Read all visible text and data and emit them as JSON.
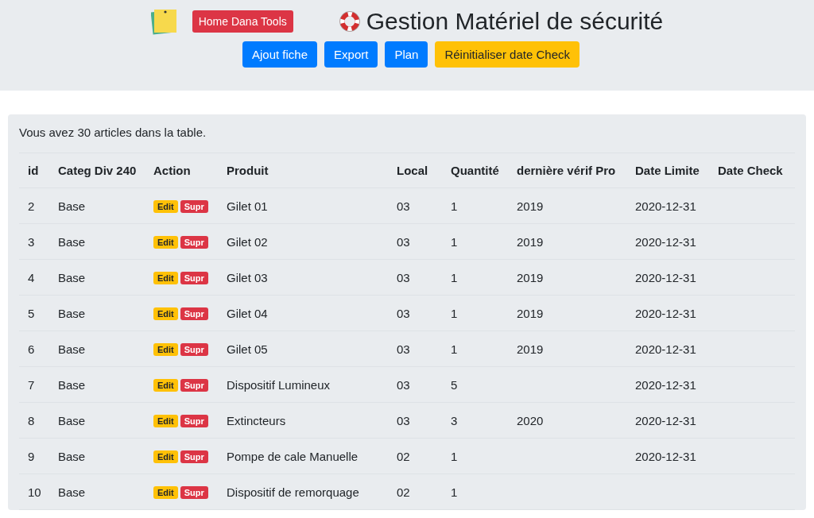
{
  "header": {
    "home_button": "Home Dana Tools",
    "title": "Gestion Matériel de sécurité",
    "buttons": [
      {
        "label": "Ajout fiche",
        "kind": "primary"
      },
      {
        "label": "Export",
        "kind": "primary"
      },
      {
        "label": "Plan",
        "kind": "primary"
      },
      {
        "label": "Réinitialiser date Check",
        "kind": "warning"
      }
    ]
  },
  "summary": "Vous avez 30 articles dans la table.",
  "table": {
    "columns": [
      "id",
      "Categ Div 240",
      "Action",
      "Produit",
      "Local",
      "Quantité",
      "dernière vérif Pro",
      "Date Limite",
      "Date Check"
    ],
    "rows": [
      {
        "id": "2",
        "categ": "Base",
        "actions": [
          "Edit",
          "Supr"
        ],
        "produit": "Gilet 01",
        "local": "03",
        "quantite": "1",
        "verif": "2019",
        "limite": "2020-12-31"
      },
      {
        "id": "3",
        "categ": "Base",
        "actions": [
          "Edit",
          "Supr"
        ],
        "produit": "Gilet 02",
        "local": "03",
        "quantite": "1",
        "verif": "2019",
        "limite": "2020-12-31"
      },
      {
        "id": "4",
        "categ": "Base",
        "actions": [
          "Edit",
          "Supr"
        ],
        "produit": "Gilet 03",
        "local": "03",
        "quantite": "1",
        "verif": "2019",
        "limite": "2020-12-31"
      },
      {
        "id": "5",
        "categ": "Base",
        "actions": [
          "Edit",
          "Supr"
        ],
        "produit": "Gilet 04",
        "local": "03",
        "quantite": "1",
        "verif": "2019",
        "limite": "2020-12-31"
      },
      {
        "id": "6",
        "categ": "Base",
        "actions": [
          "Edit",
          "Supr"
        ],
        "produit": "Gilet 05",
        "local": "03",
        "quantite": "1",
        "verif": "2019",
        "limite": "2020-12-31"
      },
      {
        "id": "7",
        "categ": "Base",
        "actions": [
          "Edit",
          "Supr"
        ],
        "produit": "Dispositif Lumineux",
        "local": "03",
        "quantite": "5",
        "limite": "2020-12-31"
      },
      {
        "id": "8",
        "categ": "Base",
        "actions": [
          "Edit",
          "Supr"
        ],
        "produit": "Extincteurs",
        "local": "03",
        "quantite": "3",
        "verif": "2020",
        "limite": "2020-12-31"
      },
      {
        "id": "9",
        "categ": "Base",
        "actions": [
          "Edit",
          "Supr"
        ],
        "produit": "Pompe de cale Manuelle",
        "local": "02",
        "quantite": "1",
        "limite": "2020-12-31"
      },
      {
        "id": "10",
        "categ": "Base",
        "actions": [
          "Edit",
          "Supr"
        ],
        "produit": "Dispositif de remorquage",
        "local": "02",
        "quantite": "1"
      }
    ]
  }
}
